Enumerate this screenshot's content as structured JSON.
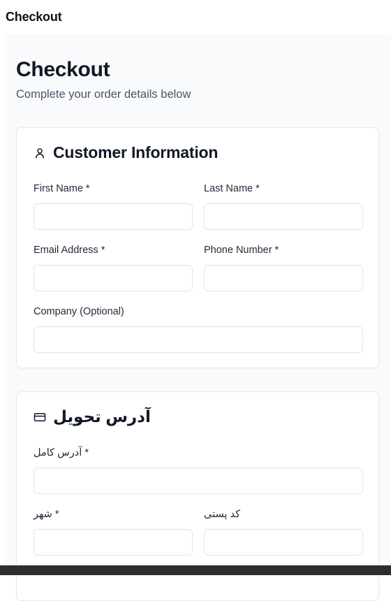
{
  "window": {
    "title": "Checkout"
  },
  "header": {
    "title": "Checkout",
    "subtitle": "Complete your order details below"
  },
  "customer": {
    "title": "Customer Information",
    "icon": "user-icon",
    "first_name_label": "First Name *",
    "last_name_label": "Last Name *",
    "email_label": "Email Address *",
    "phone_label": "Phone Number *",
    "company_label": "Company (Optional)"
  },
  "shipping": {
    "title": "آدرس تحویل",
    "icon": "credit-card-icon",
    "address_label": "* آدرس کامل",
    "city_label": "* شهر",
    "postal_label": "کد پستی"
  },
  "colors": {
    "background": "#f9fafb",
    "card": "#ffffff",
    "border": "#e5e7eb",
    "text": "#111827",
    "muted": "#4b5563"
  }
}
